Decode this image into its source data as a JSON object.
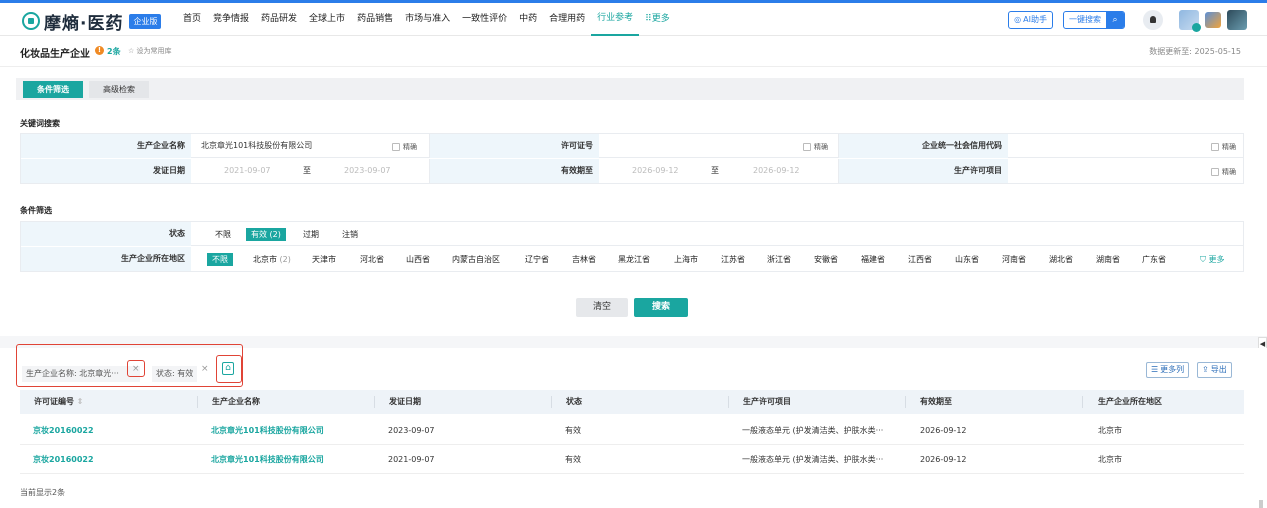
{
  "app": {
    "logo_text": "摩熵·医药",
    "badge": "企业版"
  },
  "nav": [
    "首页",
    "竞争情报",
    "药品研发",
    "全球上市",
    "药品销售",
    "市场与准入",
    "一致性评价",
    "中药",
    "合理用药",
    "行业参考"
  ],
  "nav_more": "更多",
  "toolbar": {
    "ai_label": "AI助手",
    "search_label": "一键搜索"
  },
  "header": {
    "title": "化妆品生产企业",
    "count": "2条",
    "fav": "设为常用库",
    "updated": "数据更新至: 2025-05-15"
  },
  "tabs": [
    "条件筛选",
    "高级检索"
  ],
  "keyword": {
    "title": "关键词搜索",
    "company_label": "生产企业名称",
    "company_value": "北京章光101科技股份有限公司",
    "license_label": "许可证号",
    "credit_label": "企业统一社会信用代码",
    "exact": "精确",
    "issue_label": "发证日期",
    "issue_from": "2021-09-07",
    "issue_to": "2023-09-07",
    "valid_label": "有效期至",
    "valid_from": "2026-09-12",
    "valid_to": "2026-09-12",
    "to": "至",
    "item_label": "生产许可项目"
  },
  "conditions": {
    "title": "条件筛选",
    "status_label": "状态",
    "status_options": [
      "不限",
      "有效",
      "过期",
      "注销"
    ],
    "status_count": "(2)",
    "region_label": "生产企业所在地区",
    "region_options": [
      "不限",
      "北京市",
      "天津市",
      "河北省",
      "山西省",
      "内蒙古自治区",
      "辽宁省",
      "吉林省",
      "黑龙江省",
      "上海市",
      "江苏省",
      "浙江省",
      "安徽省",
      "福建省",
      "江西省",
      "山东省",
      "河南省",
      "湖北省",
      "湖南省",
      "广东省"
    ],
    "region_count": "(2)",
    "more": "更多"
  },
  "buttons": {
    "clear": "清空",
    "search": "搜索"
  },
  "chips": {
    "company": "生产企业名称: 北京章光···",
    "status": "状态: 有效"
  },
  "tools": {
    "more_cols": "更多列",
    "export": "导出"
  },
  "table": {
    "headers": [
      "许可证编号",
      "生产企业名称",
      "发证日期",
      "状态",
      "生产许可项目",
      "有效期至",
      "生产企业所在地区"
    ],
    "rows": [
      [
        "京妆20160022",
        "北京章光101科技股份有限公司",
        "2023-09-07",
        "有效",
        "一般液态单元 (护发清洁类、护肤水类···",
        "2026-09-12",
        "北京市"
      ],
      [
        "京妆20160022",
        "北京章光101科技股份有限公司",
        "2021-09-07",
        "有效",
        "一般液态单元 (护发清洁类、护肤水类···",
        "2026-09-12",
        "北京市"
      ]
    ]
  },
  "footer": {
    "count": "当前显示2条"
  },
  "colors": {
    "accent": "#1aa6a0",
    "blue": "#2b7de9",
    "highlight": "#e04436"
  }
}
